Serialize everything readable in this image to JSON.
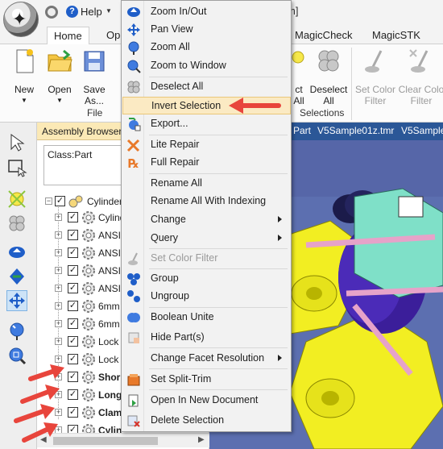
{
  "titlebar": {
    "help_label": "Help",
    "title_fragment": "m]"
  },
  "tabs": [
    {
      "label": "Home",
      "active": true
    },
    {
      "label": "Ope"
    },
    {
      "label": "MagicCheck"
    },
    {
      "label": "MagicSTK"
    }
  ],
  "ribbon": {
    "new_label": "New",
    "open_label": "Open",
    "save_label": "Save",
    "save_label2": "As...",
    "file_group": "File",
    "selections_group": "Selections",
    "select_all_frag": "ct",
    "select_all_frag2": "All",
    "deselect_label": "Deselect",
    "deselect_label2": "All",
    "set_color_label": "Set Color",
    "set_color_label2": "Filter",
    "clear_color_label": "Clear Colo",
    "clear_color_label2": "Filter"
  },
  "browser": {
    "title": "Assembly Browser",
    "class_text": "Class:Part",
    "rows": [
      {
        "label": "Cylinder C",
        "bold": false,
        "level": 0
      },
      {
        "label": "Cylinde",
        "bold": false,
        "level": 1
      },
      {
        "label": "ANSI",
        "bold": false,
        "level": 1
      },
      {
        "label": "ANSI",
        "bold": false,
        "level": 1
      },
      {
        "label": "ANSI",
        "bold": false,
        "level": 1
      },
      {
        "label": "ANSI",
        "bold": false,
        "level": 1
      },
      {
        "label": "6mm",
        "bold": false,
        "level": 1
      },
      {
        "label": "6mm",
        "bold": false,
        "level": 1
      },
      {
        "label": "Lock",
        "bold": false,
        "level": 1
      },
      {
        "label": "Lock",
        "bold": false,
        "level": 1
      },
      {
        "label": "Shor",
        "bold": true,
        "level": 1
      },
      {
        "label": "Long",
        "bold": true,
        "level": 1
      },
      {
        "label": "Clam",
        "bold": true,
        "level": 1
      },
      {
        "label": "Cylin",
        "bold": true,
        "level": 1
      }
    ]
  },
  "doctabs": [
    "Part",
    "V5Sample01z.tmr",
    "V5Sample"
  ],
  "menu": {
    "items": [
      {
        "label": "Zoom In/Out",
        "icon": "zoom-in-out-icon"
      },
      {
        "label": "Pan View",
        "icon": "pan-view-icon"
      },
      {
        "label": "Zoom All",
        "icon": "zoom-all-icon"
      },
      {
        "label": "Zoom to Window",
        "icon": "zoom-window-icon"
      },
      {
        "label": "Deselect All",
        "icon": "deselect-all-icon"
      },
      {
        "label": "Invert Selection",
        "icon": "",
        "highlighted": true
      },
      {
        "label": "Export...",
        "icon": "export-icon"
      },
      {
        "label": "Lite Repair",
        "icon": "lite-repair-icon"
      },
      {
        "label": "Full Repair",
        "icon": "full-repair-icon"
      },
      {
        "label": "Rename All",
        "icon": ""
      },
      {
        "label": "Rename All With Indexing",
        "icon": ""
      },
      {
        "label": "Change",
        "icon": "",
        "submenu": true
      },
      {
        "label": "Query",
        "icon": "",
        "submenu": true
      },
      {
        "label": "Set Color Filter",
        "icon": "set-color-filter-icon",
        "disabled": true
      },
      {
        "label": "Group",
        "icon": "group-icon"
      },
      {
        "label": "Ungroup",
        "icon": "ungroup-icon"
      },
      {
        "label": "Boolean Unite",
        "icon": "boolean-unite-icon"
      },
      {
        "label": "Hide Part(s)",
        "icon": "hide-parts-icon"
      },
      {
        "label": "Change Facet Resolution",
        "icon": "",
        "submenu": true
      },
      {
        "label": "Set Split-Trim",
        "icon": "split-trim-icon"
      },
      {
        "label": "Open In New Document",
        "icon": "open-new-document-icon"
      },
      {
        "label": "Delete Selection",
        "icon": "delete-selection-icon"
      }
    ]
  },
  "colors": {
    "menu_highlight": "#fbeac3",
    "browser_title_bg": "#fbe9b6",
    "arrow_red": "#e8453c",
    "viewport_blue": "#5c6fb0",
    "part_yellow": "#f2ee22",
    "part_teal": "#7fe0c8"
  }
}
